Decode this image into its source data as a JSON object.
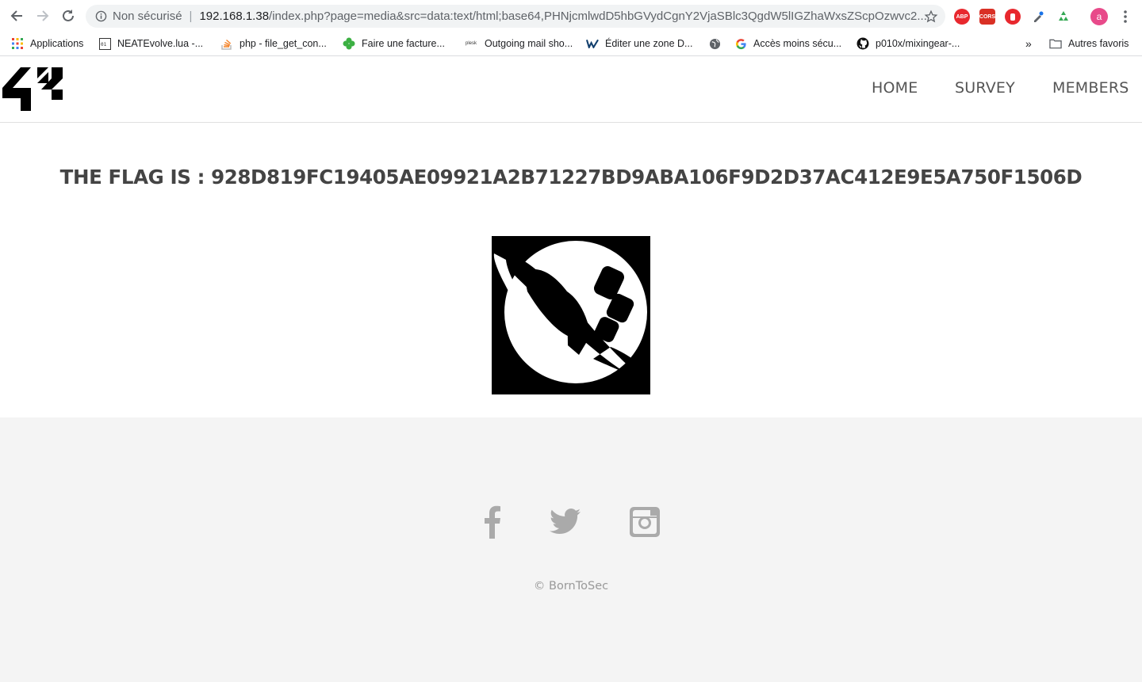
{
  "browser": {
    "security_label": "Non sécurisé",
    "url_host": "192.168.1.38",
    "url_rest": "/index.php?page=media&src=data:text/html;base64,PHNjcmlwdD5hbGVydCgnY2VjaSBlc3QgdW5lIGZhaWxsZScpOzwvc2...",
    "profile_initial": "a",
    "extensions": [
      "ABP",
      "CORS"
    ]
  },
  "bookmarks": [
    {
      "label": "Applications",
      "icon": "apps-grid-icon"
    },
    {
      "label": "NEATEvolve.lua -...",
      "icon": "code-icon"
    },
    {
      "label": "php - file_get_con...",
      "icon": "stackoverflow-icon"
    },
    {
      "label": "Faire une facture...",
      "icon": "clover-icon"
    },
    {
      "label": "Outgoing mail sho...",
      "icon": "plesk-icon"
    },
    {
      "label": "Éditer une zone D...",
      "icon": "ovh-icon"
    },
    {
      "label": "",
      "icon": "globe-icon"
    },
    {
      "label": "Accès moins sécu...",
      "icon": "google-icon"
    },
    {
      "label": "p010x/mixingear-...",
      "icon": "github-icon"
    }
  ],
  "bookmarks_overflow": "»",
  "other_bookmarks": "Autres favoris",
  "plesk_label": "plesk",
  "nav": {
    "home": "HOME",
    "survey": "SURVEY",
    "members": "MEMBERS"
  },
  "flag_text": "THE FLAG IS : 928D819FC19405AE09921A2B71227BD9ABA106F9D2D37AC412E9E5A750F1506D",
  "footer": {
    "copyright": "© BornToSec",
    "social": [
      "facebook-icon",
      "twitter-icon",
      "instagram-icon"
    ]
  },
  "colors": {
    "nav_text": "#555555",
    "footer_bg": "#f4f4f4",
    "social_icon": "#aaaaaa"
  }
}
